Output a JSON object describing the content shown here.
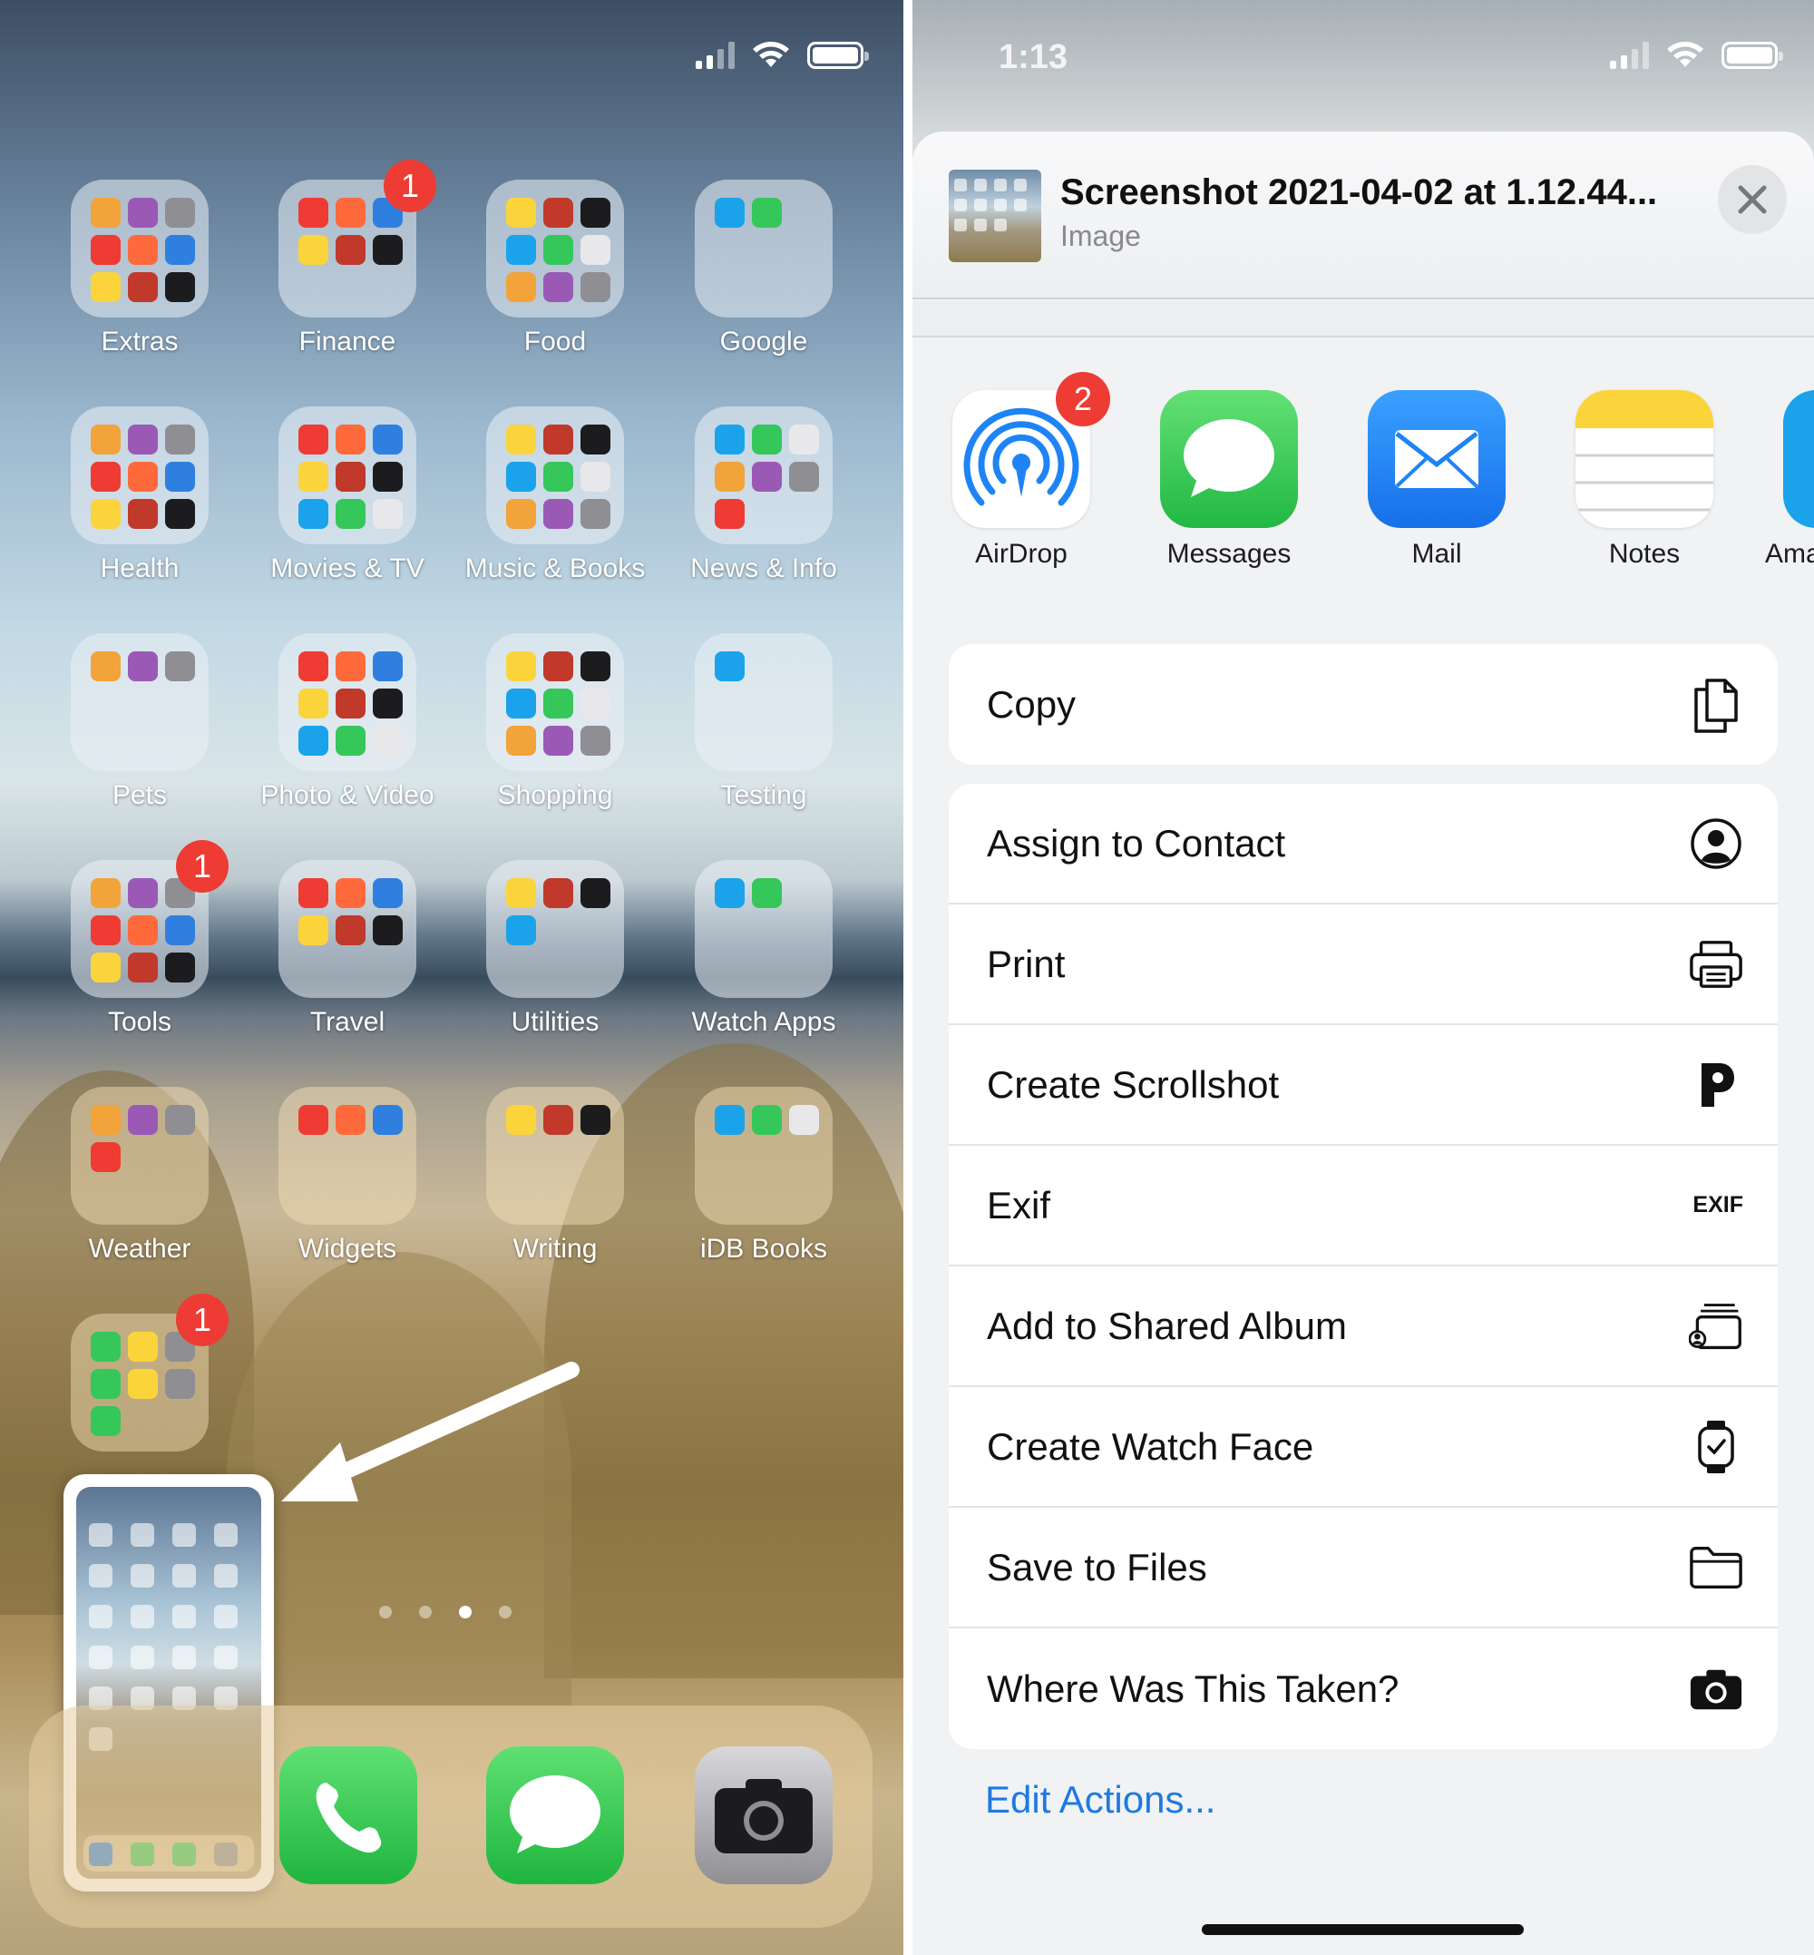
{
  "left": {
    "folders": [
      {
        "label": "Extras",
        "badge": ""
      },
      {
        "label": "Finance",
        "badge": "1"
      },
      {
        "label": "Food",
        "badge": ""
      },
      {
        "label": "Google",
        "badge": ""
      },
      {
        "label": "Health",
        "badge": ""
      },
      {
        "label": "Movies & TV",
        "badge": ""
      },
      {
        "label": "Music & Books",
        "badge": ""
      },
      {
        "label": "News & Info",
        "badge": ""
      },
      {
        "label": "Pets",
        "badge": ""
      },
      {
        "label": "Photo & Video",
        "badge": ""
      },
      {
        "label": "Shopping",
        "badge": ""
      },
      {
        "label": "Testing",
        "badge": ""
      },
      {
        "label": "Tools",
        "badge": "1"
      },
      {
        "label": "Travel",
        "badge": ""
      },
      {
        "label": "Utilities",
        "badge": ""
      },
      {
        "label": "Watch Apps",
        "badge": ""
      },
      {
        "label": "Weather",
        "badge": ""
      },
      {
        "label": "Widgets",
        "badge": ""
      },
      {
        "label": "Writing",
        "badge": ""
      },
      {
        "label": "iDB Books",
        "badge": ""
      }
    ],
    "extra_folder_badge": "1",
    "dock_apps": [
      "phone-icon",
      "messages-icon",
      "camera-icon"
    ],
    "page_dots": {
      "count": 4,
      "active": 3
    }
  },
  "right": {
    "status_time": "1:13",
    "header": {
      "title": "Screenshot 2021-04-02 at 1.12.44...",
      "subtitle": "Image"
    },
    "share_apps": [
      {
        "label": "AirDrop",
        "icon": "airdrop-icon",
        "badge": "2"
      },
      {
        "label": "Messages",
        "icon": "messages-icon",
        "badge": ""
      },
      {
        "label": "Mail",
        "icon": "mail-icon",
        "badge": ""
      },
      {
        "label": "Notes",
        "icon": "notes-icon",
        "badge": ""
      },
      {
        "label": "Ama",
        "icon": "amazon-icon",
        "badge": ""
      }
    ],
    "actions_group1": [
      {
        "label": "Copy",
        "icon": "copy-icon"
      }
    ],
    "actions_group2": [
      {
        "label": "Assign to Contact",
        "icon": "contact-icon"
      },
      {
        "label": "Print",
        "icon": "printer-icon"
      },
      {
        "label": "Create Scrollshot",
        "icon": "picsew-icon"
      },
      {
        "label": "Exif",
        "icon": "exif-icon",
        "icon_text": "EXIF"
      },
      {
        "label": "Add to Shared Album",
        "icon": "shared-album-icon"
      },
      {
        "label": "Create Watch Face",
        "icon": "watch-icon"
      },
      {
        "label": "Save to Files",
        "icon": "folder-icon"
      },
      {
        "label": "Where Was This Taken?",
        "icon": "camera-icon"
      }
    ],
    "edit_actions": "Edit Actions...",
    "colors": {
      "accent": "#1d7ae0",
      "badge": "#ee3b33",
      "messages_green": "#35c759",
      "mail_blue": "#1e84f5",
      "notes_yellow": "#fbd43c"
    }
  }
}
